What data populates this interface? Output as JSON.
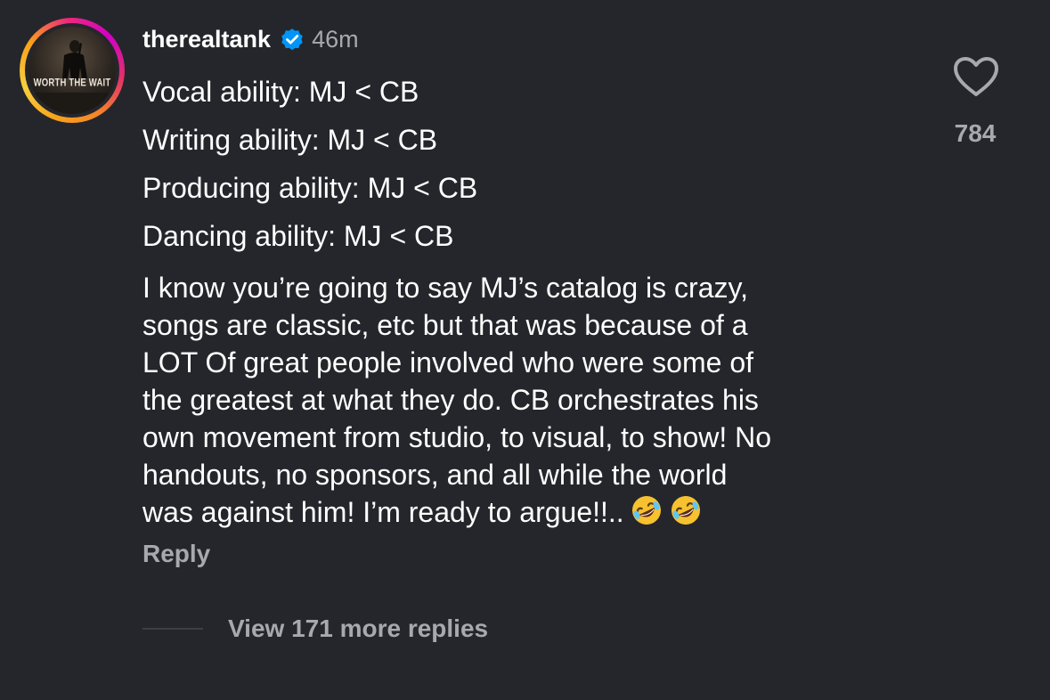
{
  "comment": {
    "username": "therealtank",
    "verified": true,
    "time_ago": "46m",
    "avatar": {
      "icon": "profile-photo",
      "caption": "WORTH THE WAIT"
    },
    "lines": [
      "Vocal ability: MJ < CB",
      "Writing ability: MJ < CB",
      "Producing ability: MJ < CB",
      "Dancing ability: MJ < CB"
    ],
    "paragraph_lines": [
      "I know you’re going to say MJ’s catalog is crazy,",
      "songs are classic, etc but that was because of a",
      "LOT Of great people involved who were some of",
      "the greatest at what they do.  CB orchestrates his",
      "own movement from studio, to visual, to show! No",
      "handouts, no sponsors, and all while the world",
      "was against him! I’m ready to argue!!.."
    ],
    "trailing_emojis": [
      "rolling-on-floor-laughing-emoji",
      "rolling-on-floor-laughing-emoji"
    ],
    "reply_label": "Reply",
    "view_replies_label": "View 171 more replies",
    "like_icon": "heart-outline-icon",
    "like_count": "784"
  },
  "colors": {
    "background": "#25262b",
    "text_primary": "#ffffff",
    "text_secondary": "#a8a8ad",
    "verified_badge": "#0095f6"
  }
}
